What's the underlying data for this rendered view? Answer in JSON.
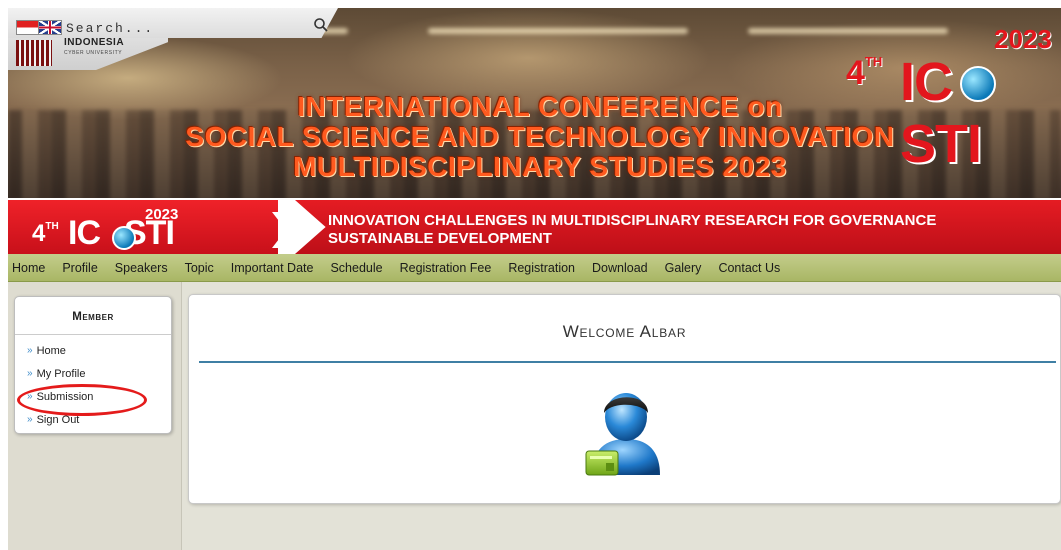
{
  "search": {
    "placeholder": "Search..."
  },
  "university": {
    "name": "INDONESIA",
    "subtitle": "CYBER UNIVERSITY"
  },
  "conference": {
    "title_lines": [
      "INTERNATIONAL CONFERENCE on",
      "SOCIAL SCIENCE AND TECHNOLOGY INNOVATION",
      "MULTIDISCIPLINARY STUDIES 2023"
    ],
    "edition_prefix": "4",
    "edition_suffix": "TH",
    "name_left": "IC",
    "name_right": "STI",
    "year": "2023"
  },
  "tagline": {
    "lines": [
      "INNOVATION CHALLENGES IN MULTIDISCIPLINARY RESEARCH FOR GOVERNANCE",
      "SUSTAINABLE DEVELOPMENT"
    ]
  },
  "nav": {
    "items": [
      "Home",
      "Profile",
      "Speakers",
      "Topic",
      "Important Date",
      "Schedule",
      "Registration Fee",
      "Registration",
      "Download",
      "Galery",
      "Contact Us"
    ]
  },
  "member": {
    "title": "Member",
    "items": [
      "Home",
      "My Profile",
      "Submission",
      "Sign Out"
    ]
  },
  "main": {
    "welcome": "Welcome Albar"
  },
  "colors": {
    "accent_red": "#e51c23",
    "nav_green": "#b4bf74",
    "title_orange": "#ff5a1f",
    "highlight": "#e41b1b",
    "link_blue": "#3d8cc9"
  }
}
